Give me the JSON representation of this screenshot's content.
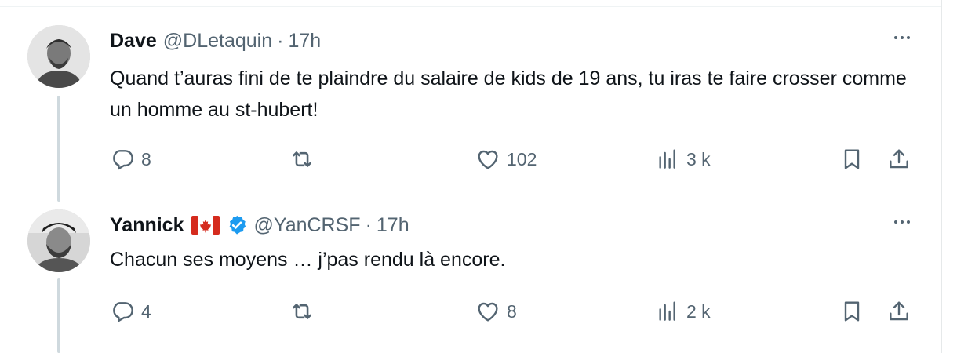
{
  "tweets": [
    {
      "name": "Dave",
      "handle": "@DLetaquin",
      "separator": "·",
      "time": "17h",
      "text": "Quand t’auras fini de te plaindre du salaire de kids de 19 ans, tu iras te faire crosser comme un homme au st-hubert!",
      "replies": "8",
      "retweets": "",
      "likes": "102",
      "views": "3 k",
      "has_flag": false,
      "verified": false
    },
    {
      "name": "Yannick",
      "handle": "@YanCRSF",
      "separator": "·",
      "time": "17h",
      "text": "Chacun ses moyens … j’pas rendu là encore.",
      "replies": "4",
      "retweets": "",
      "likes": "8",
      "views": "2 k",
      "has_flag": true,
      "verified": true
    }
  ],
  "colors": {
    "text": "#0f1419",
    "secondary": "#536471",
    "verified": "#1d9bf0",
    "thread_line": "#cfd9de",
    "flag_red": "#d52b1e"
  },
  "icons": [
    "reply-icon",
    "retweet-icon",
    "like-icon",
    "views-icon",
    "bookmark-icon",
    "share-icon",
    "more-icon",
    "verified-badge-icon",
    "canada-flag-icon"
  ]
}
